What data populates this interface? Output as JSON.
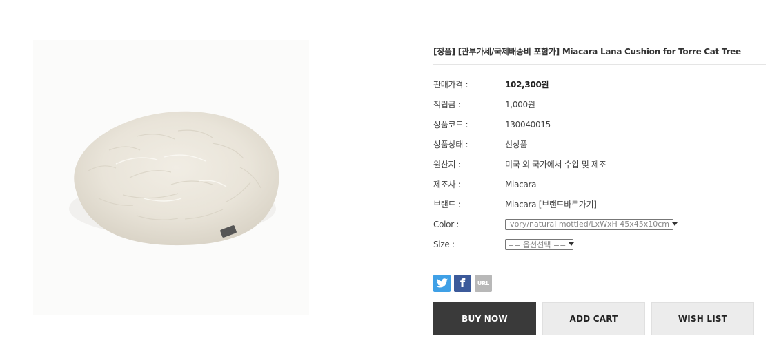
{
  "product": {
    "title": "[정품] [관부가세/국제배송비 포함가] Miacara Lana Cushion for Torre Cat Tree",
    "image_alt": "ivory fur round cushion"
  },
  "specs": [
    {
      "label": "판매가격 :",
      "value": "102,300원"
    },
    {
      "label": "적립금 :",
      "value": "1,000원"
    },
    {
      "label": "상품코드 :",
      "value": "130040015"
    },
    {
      "label": "상품상태 :",
      "value": "신상품"
    },
    {
      "label": "원산지 :",
      "value": "미국 외 국가에서 수입 및 제조"
    },
    {
      "label": "제조사 :",
      "value": "Miacara"
    },
    {
      "label": "브랜드 :",
      "value": "Miacara [브랜드바로가기]"
    }
  ],
  "options": {
    "color": {
      "label": "Color :",
      "selected": "ivory/natural mottled/LxWxH 45x45x10cm"
    },
    "size": {
      "label": "Size :",
      "selected": "== 옵션선택 =="
    }
  },
  "share": {
    "twitter_icon": "twitter-icon",
    "facebook_glyph": "f",
    "url_label": "URL"
  },
  "actions": {
    "buy_now": "BUY NOW",
    "add_cart": "ADD CART",
    "wish_list": "WISH LIST"
  },
  "colors": {
    "buy_bg": "#3a3a3a",
    "secondary_bg": "#ececec",
    "twitter": "#3fa0e6",
    "facebook": "#3c5a9a",
    "url": "#b8b8b8"
  }
}
